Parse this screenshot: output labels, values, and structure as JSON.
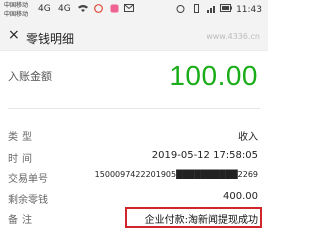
{
  "status": {
    "carrier1": "中国移动",
    "carrier2": "中国移动",
    "signal1": "4G",
    "signal2": "4G",
    "time": "11:43"
  },
  "header": {
    "back_icon": "×",
    "title": "零钱明细",
    "watermark": "www.4336.cn"
  },
  "amount": {
    "label": "入账金额",
    "value": "100.00",
    "color": "#1aad19"
  },
  "details": {
    "type_label": "类型",
    "type_value": "收入",
    "time_label": "时间",
    "time_value": "2019-05-12 17:58:05",
    "txn_label": "交易单号",
    "txn_value": "1500097422201905██████████2269",
    "balance_label": "剩余零钱",
    "balance_value": "400.00",
    "note_label": "备注",
    "note_value": "企业付款:淘新闻提现成功"
  }
}
